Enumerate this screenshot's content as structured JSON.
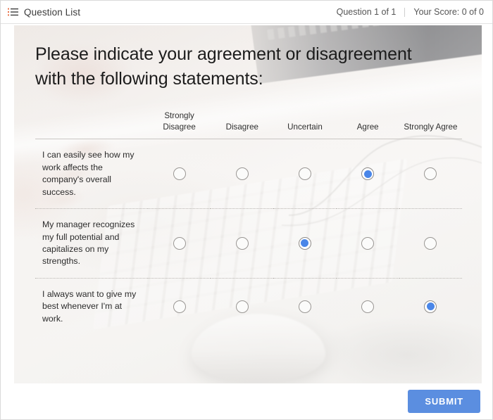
{
  "window": {
    "title": "Question List"
  },
  "topbar": {
    "icon": "list-icon",
    "title": "Question List",
    "question_counter": "Question 1 of 1",
    "separator": "|",
    "score": "Your Score: 0 of 0"
  },
  "survey": {
    "title": "Please indicate your agreement or disagreement with the following statements:",
    "statement_column_header": "",
    "scale": [
      "Strongly Disagree",
      "Disagree",
      "Uncertain",
      "Agree",
      "Strongly Agree"
    ],
    "rows": [
      {
        "statement": "I can easily see how my work affects the company's overall success.",
        "selected_index": 3,
        "selected_label": "Agree"
      },
      {
        "statement": "My manager recognizes my full potential and capitalizes on my strengths.",
        "selected_index": 2,
        "selected_label": "Uncertain"
      },
      {
        "statement": "I always want to give my best whenever I'm at work.",
        "selected_index": 4,
        "selected_label": "Strongly Agree"
      }
    ]
  },
  "footer": {
    "submit_label": "SUBMIT"
  },
  "colors": {
    "accent_blue": "#4a86e8",
    "submit_button": "#5b8ee0",
    "panel_background": "#efeeec",
    "text_primary": "#1c1c1c",
    "text_secondary": "#555555",
    "rule": "#c9c6c3"
  }
}
